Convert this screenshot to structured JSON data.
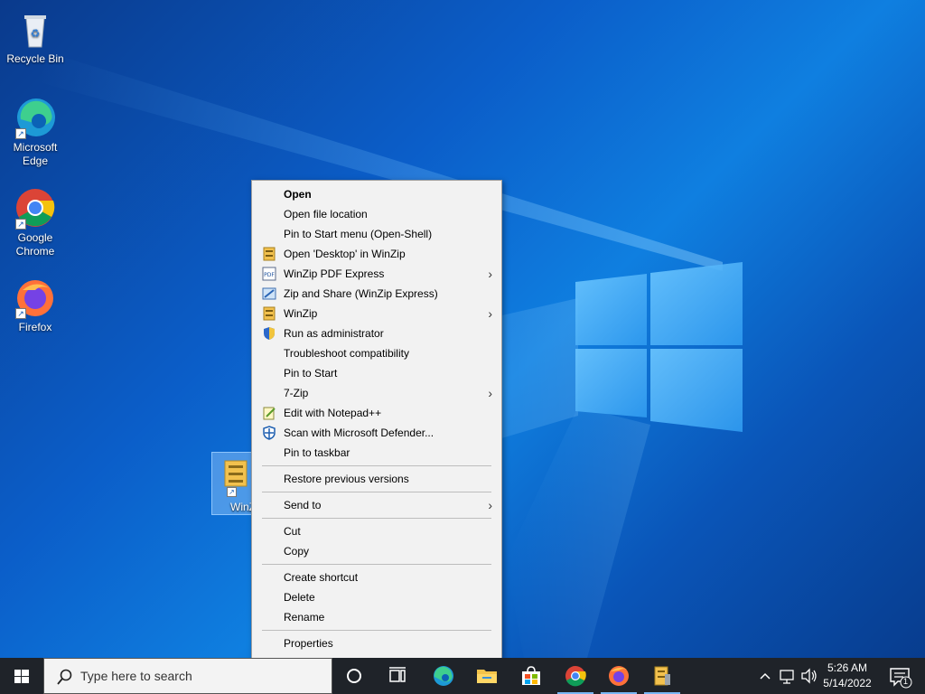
{
  "desktop": {
    "icons": [
      {
        "label": "Recycle Bin",
        "icon": "recycle-bin-icon"
      },
      {
        "label": "Microsoft Edge",
        "icon": "edge-icon"
      },
      {
        "label": "Google Chrome",
        "icon": "chrome-icon"
      },
      {
        "label": "Firefox",
        "icon": "firefox-icon"
      },
      {
        "label": "WinZ",
        "icon": "winzip-icon"
      }
    ]
  },
  "context_menu": {
    "items": [
      {
        "label": "Open"
      },
      {
        "label": "Open file location"
      },
      {
        "label": "Pin to Start menu (Open-Shell)"
      },
      {
        "label": "Open 'Desktop' in WinZip",
        "icon": "winzip-icon"
      },
      {
        "label": "WinZip PDF Express",
        "icon": "pdf-icon"
      },
      {
        "label": "Zip and Share (WinZip Express)",
        "icon": "zip-share-icon"
      },
      {
        "label": "WinZip",
        "icon": "winzip-icon"
      },
      {
        "label": "Run as administrator",
        "icon": "uac-shield-icon"
      },
      {
        "label": "Troubleshoot compatibility"
      },
      {
        "label": "Pin to Start"
      },
      {
        "label": "7-Zip"
      },
      {
        "label": "Edit with Notepad++",
        "icon": "notepad-plus-icon"
      },
      {
        "label": "Scan with Microsoft Defender...",
        "icon": "defender-icon"
      },
      {
        "label": "Pin to taskbar"
      },
      {
        "label": "Restore previous versions"
      },
      {
        "label": "Send to"
      },
      {
        "label": "Cut"
      },
      {
        "label": "Copy"
      },
      {
        "label": "Create shortcut"
      },
      {
        "label": "Delete"
      },
      {
        "label": "Rename"
      },
      {
        "label": "Properties"
      }
    ],
    "submenu_arrow": "›"
  },
  "taskbar": {
    "search_placeholder": "Type here to search",
    "apps": [
      "task-view-icon",
      "edge-icon",
      "file-explorer-icon",
      "store-icon",
      "chrome-icon",
      "firefox-icon",
      "winzip-icon"
    ],
    "clock_time": "5:26 AM",
    "clock_date": "5/14/2022",
    "notification_count": "1"
  },
  "colors": {
    "taskbar": "#1f2329",
    "menu_bg": "#f2f2f2",
    "accent": "#0078d7"
  }
}
